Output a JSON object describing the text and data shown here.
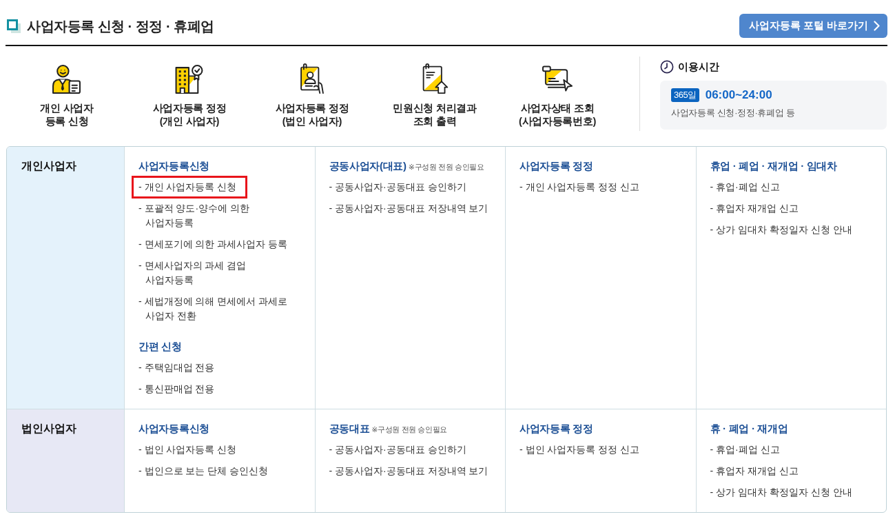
{
  "page": {
    "title": "사업자등록 신청 · 정정 · 휴폐업",
    "portal_button": "사업자등록 포털 바로가기"
  },
  "quick_menu": [
    {
      "kind": "person",
      "label": "개인 사업자\n등록 신청"
    },
    {
      "kind": "building",
      "label": "사업자등록 정정\n(개인 사업자)"
    },
    {
      "kind": "profile",
      "label": "사업자등록 정정\n(법인 사업자)"
    },
    {
      "kind": "document",
      "label": "민원신청 처리결과\n조회 출력"
    },
    {
      "kind": "card",
      "label": "사업자상태 조회\n(사업자등록번호)"
    }
  ],
  "hours": {
    "title": "이용시간",
    "badge": "365일",
    "time": "06:00~24:00",
    "note": "사업자등록 신청·정정·휴폐업 등"
  },
  "table": {
    "rows": [
      {
        "header": "개인사업자",
        "color": "#e4f2fb",
        "cells": [
          {
            "groups": [
              {
                "heading": "사업자등록신청",
                "items": [
                  {
                    "label": "- 개인 사업자등록 신청",
                    "highlighted": true
                  },
                  {
                    "label": "- 포괄적 양도·양수에 의한 사업자등록",
                    "highlighted": false
                  },
                  {
                    "label": "- 면세포기에 의한 과세사업자 등록",
                    "highlighted": false
                  },
                  {
                    "label": "- 면세사업자의 과세 겸업 사업자등록",
                    "highlighted": false
                  },
                  {
                    "label": "- 세법개정에 의해 면세에서 과세로 사업자 전환",
                    "highlighted": false
                  }
                ]
              },
              {
                "heading": "간편 신청",
                "items": [
                  {
                    "label": "- 주택임대업 전용",
                    "highlighted": false
                  },
                  {
                    "label": "- 통신판매업 전용",
                    "highlighted": false
                  }
                ]
              }
            ]
          },
          {
            "groups": [
              {
                "heading": "공동사업자(대표)",
                "note": "※구성원 전원 승인필요",
                "items": [
                  {
                    "label": "- 공동사업자·공동대표 승인하기",
                    "highlighted": false
                  },
                  {
                    "label": "- 공동사업자·공동대표 저장내역 보기",
                    "highlighted": false
                  }
                ]
              }
            ]
          },
          {
            "groups": [
              {
                "heading": "사업자등록 정정",
                "items": [
                  {
                    "label": "- 개인 사업자등록 정정 신고",
                    "highlighted": false
                  }
                ]
              }
            ]
          },
          {
            "groups": [
              {
                "heading": "휴업 · 폐업 · 재개업 · 임대차",
                "items": [
                  {
                    "label": "- 휴업·폐업 신고",
                    "highlighted": false
                  },
                  {
                    "label": "- 휴업자 재개업 신고",
                    "highlighted": false
                  },
                  {
                    "label": "- 상가 임대차 확정일자 신청 안내",
                    "highlighted": false
                  }
                ]
              }
            ]
          }
        ]
      },
      {
        "header": "법인사업자",
        "color": "#e7e8f5",
        "cells": [
          {
            "groups": [
              {
                "heading": "사업자등록신청",
                "items": [
                  {
                    "label": "- 법인 사업자등록 신청",
                    "highlighted": false
                  },
                  {
                    "label": "- 법인으로 보는 단체 승인신청",
                    "highlighted": false
                  }
                ]
              }
            ]
          },
          {
            "groups": [
              {
                "heading": "공동대표",
                "note": "※구성원 전원 승인필요",
                "items": [
                  {
                    "label": "- 공동사업자·공동대표 승인하기",
                    "highlighted": false
                  },
                  {
                    "label": "- 공동사업자·공동대표 저장내역 보기",
                    "highlighted": false
                  }
                ]
              }
            ]
          },
          {
            "groups": [
              {
                "heading": "사업자등록 정정",
                "items": [
                  {
                    "label": "- 법인 사업자등록 정정 신고",
                    "highlighted": false
                  }
                ]
              }
            ]
          },
          {
            "groups": [
              {
                "heading": "휴 · 폐업 · 재개업",
                "items": [
                  {
                    "label": "- 휴업·폐업 신고",
                    "highlighted": false
                  },
                  {
                    "label": "- 휴업자 재개업 신고",
                    "highlighted": false
                  },
                  {
                    "label": "- 상가 임대차 확정일자 신청 안내",
                    "highlighted": false
                  }
                ]
              }
            ]
          }
        ]
      }
    ]
  }
}
